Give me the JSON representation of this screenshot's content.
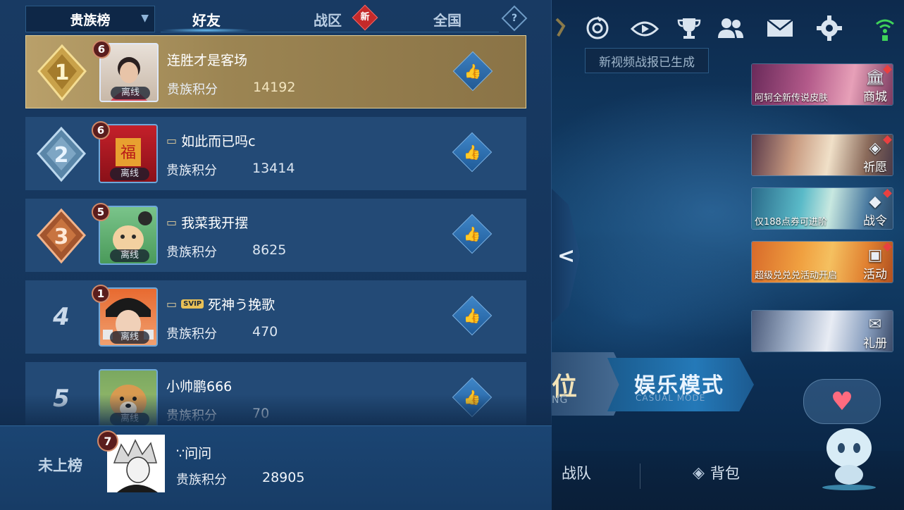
{
  "panel": {
    "dropdown_label": "贵族榜",
    "tabs": [
      {
        "label": "好友",
        "active": true
      },
      {
        "label": "战区",
        "active": false,
        "badge": "新"
      },
      {
        "label": "全国",
        "active": false
      }
    ],
    "help_glyph": "?",
    "offline_label": "离线",
    "score_label": "贵族积分",
    "rows": [
      {
        "rank": "1",
        "level": "6",
        "name": "连胜才是客场",
        "score": "14192",
        "has_tag": false,
        "vip": ""
      },
      {
        "rank": "2",
        "level": "6",
        "name": "如此而已吗c",
        "score": "13414",
        "has_tag": true,
        "vip": ""
      },
      {
        "rank": "3",
        "level": "5",
        "name": "我菜我开摆",
        "score": "8625",
        "has_tag": true,
        "vip": ""
      },
      {
        "rank": "4",
        "level": "1",
        "name": "死神う挽歌",
        "score": "470",
        "has_tag": true,
        "vip": "SVIP"
      },
      {
        "rank": "5",
        "level": "",
        "name": "小帅鹏666",
        "score": "70",
        "has_tag": false,
        "vip": ""
      }
    ],
    "self": {
      "rank_text": "未上榜",
      "level": "7",
      "name": "∵问问",
      "score": "28905"
    }
  },
  "topbar": {
    "icons": [
      "bell-icon",
      "target-icon",
      "replay-icon",
      "trophy-icon",
      "friends-icon",
      "mail-icon",
      "settings-icon"
    ],
    "tooltip": "新视频战报已生成"
  },
  "promos": [
    {
      "caption": "阿轲全新传说皮肤",
      "label": "商城",
      "glyph": "🏛"
    },
    {
      "caption": "",
      "label": "祈愿",
      "glyph": "◈"
    },
    {
      "caption": "仅188点券可进阶",
      "label": "战令",
      "glyph": "◆"
    },
    {
      "caption": "超级兑兑兑活动开启",
      "label": "活动",
      "glyph": "▣"
    },
    {
      "caption": "",
      "label": "礼册",
      "glyph": "✉"
    }
  ],
  "modes": {
    "ranked_label": "位",
    "ranked_sub": "NG",
    "casual_label": "娱乐模式",
    "casual_sub": "CASUAL MODE"
  },
  "bottombar": {
    "team_label": "战队",
    "bag_label": "背包"
  },
  "colors": {
    "panel_bg": "#183a63",
    "row_bg": "#234a76",
    "gold_row": "#b9a06a",
    "like_blue": "#3f86c8",
    "badge_red": "#c42a2a"
  }
}
